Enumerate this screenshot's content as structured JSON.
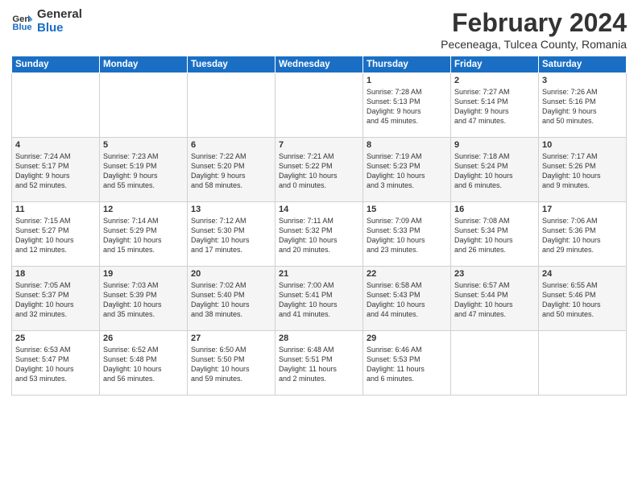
{
  "logo": {
    "line1": "General",
    "line2": "Blue"
  },
  "title": "February 2024",
  "location": "Peceneaga, Tulcea County, Romania",
  "days_header": [
    "Sunday",
    "Monday",
    "Tuesday",
    "Wednesday",
    "Thursday",
    "Friday",
    "Saturday"
  ],
  "weeks": [
    [
      {
        "day": "",
        "content": ""
      },
      {
        "day": "",
        "content": ""
      },
      {
        "day": "",
        "content": ""
      },
      {
        "day": "",
        "content": ""
      },
      {
        "day": "1",
        "content": "Sunrise: 7:28 AM\nSunset: 5:13 PM\nDaylight: 9 hours\nand 45 minutes."
      },
      {
        "day": "2",
        "content": "Sunrise: 7:27 AM\nSunset: 5:14 PM\nDaylight: 9 hours\nand 47 minutes."
      },
      {
        "day": "3",
        "content": "Sunrise: 7:26 AM\nSunset: 5:16 PM\nDaylight: 9 hours\nand 50 minutes."
      }
    ],
    [
      {
        "day": "4",
        "content": "Sunrise: 7:24 AM\nSunset: 5:17 PM\nDaylight: 9 hours\nand 52 minutes."
      },
      {
        "day": "5",
        "content": "Sunrise: 7:23 AM\nSunset: 5:19 PM\nDaylight: 9 hours\nand 55 minutes."
      },
      {
        "day": "6",
        "content": "Sunrise: 7:22 AM\nSunset: 5:20 PM\nDaylight: 9 hours\nand 58 minutes."
      },
      {
        "day": "7",
        "content": "Sunrise: 7:21 AM\nSunset: 5:22 PM\nDaylight: 10 hours\nand 0 minutes."
      },
      {
        "day": "8",
        "content": "Sunrise: 7:19 AM\nSunset: 5:23 PM\nDaylight: 10 hours\nand 3 minutes."
      },
      {
        "day": "9",
        "content": "Sunrise: 7:18 AM\nSunset: 5:24 PM\nDaylight: 10 hours\nand 6 minutes."
      },
      {
        "day": "10",
        "content": "Sunrise: 7:17 AM\nSunset: 5:26 PM\nDaylight: 10 hours\nand 9 minutes."
      }
    ],
    [
      {
        "day": "11",
        "content": "Sunrise: 7:15 AM\nSunset: 5:27 PM\nDaylight: 10 hours\nand 12 minutes."
      },
      {
        "day": "12",
        "content": "Sunrise: 7:14 AM\nSunset: 5:29 PM\nDaylight: 10 hours\nand 15 minutes."
      },
      {
        "day": "13",
        "content": "Sunrise: 7:12 AM\nSunset: 5:30 PM\nDaylight: 10 hours\nand 17 minutes."
      },
      {
        "day": "14",
        "content": "Sunrise: 7:11 AM\nSunset: 5:32 PM\nDaylight: 10 hours\nand 20 minutes."
      },
      {
        "day": "15",
        "content": "Sunrise: 7:09 AM\nSunset: 5:33 PM\nDaylight: 10 hours\nand 23 minutes."
      },
      {
        "day": "16",
        "content": "Sunrise: 7:08 AM\nSunset: 5:34 PM\nDaylight: 10 hours\nand 26 minutes."
      },
      {
        "day": "17",
        "content": "Sunrise: 7:06 AM\nSunset: 5:36 PM\nDaylight: 10 hours\nand 29 minutes."
      }
    ],
    [
      {
        "day": "18",
        "content": "Sunrise: 7:05 AM\nSunset: 5:37 PM\nDaylight: 10 hours\nand 32 minutes."
      },
      {
        "day": "19",
        "content": "Sunrise: 7:03 AM\nSunset: 5:39 PM\nDaylight: 10 hours\nand 35 minutes."
      },
      {
        "day": "20",
        "content": "Sunrise: 7:02 AM\nSunset: 5:40 PM\nDaylight: 10 hours\nand 38 minutes."
      },
      {
        "day": "21",
        "content": "Sunrise: 7:00 AM\nSunset: 5:41 PM\nDaylight: 10 hours\nand 41 minutes."
      },
      {
        "day": "22",
        "content": "Sunrise: 6:58 AM\nSunset: 5:43 PM\nDaylight: 10 hours\nand 44 minutes."
      },
      {
        "day": "23",
        "content": "Sunrise: 6:57 AM\nSunset: 5:44 PM\nDaylight: 10 hours\nand 47 minutes."
      },
      {
        "day": "24",
        "content": "Sunrise: 6:55 AM\nSunset: 5:46 PM\nDaylight: 10 hours\nand 50 minutes."
      }
    ],
    [
      {
        "day": "25",
        "content": "Sunrise: 6:53 AM\nSunset: 5:47 PM\nDaylight: 10 hours\nand 53 minutes."
      },
      {
        "day": "26",
        "content": "Sunrise: 6:52 AM\nSunset: 5:48 PM\nDaylight: 10 hours\nand 56 minutes."
      },
      {
        "day": "27",
        "content": "Sunrise: 6:50 AM\nSunset: 5:50 PM\nDaylight: 10 hours\nand 59 minutes."
      },
      {
        "day": "28",
        "content": "Sunrise: 6:48 AM\nSunset: 5:51 PM\nDaylight: 11 hours\nand 2 minutes."
      },
      {
        "day": "29",
        "content": "Sunrise: 6:46 AM\nSunset: 5:53 PM\nDaylight: 11 hours\nand 6 minutes."
      },
      {
        "day": "",
        "content": ""
      },
      {
        "day": "",
        "content": ""
      }
    ]
  ]
}
